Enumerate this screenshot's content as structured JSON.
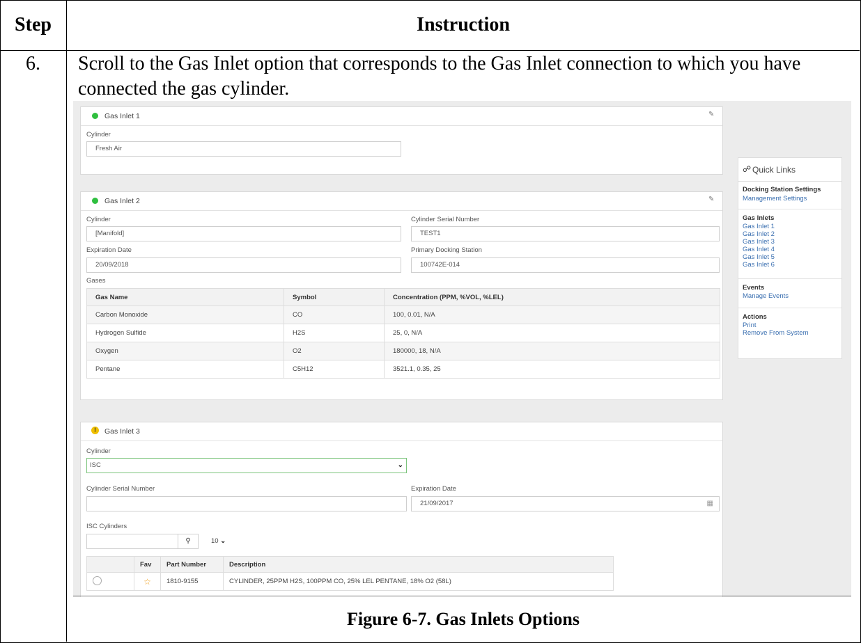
{
  "header": {
    "step": "Step",
    "instruction": "Instruction"
  },
  "row": {
    "step_number": "6.",
    "instruction_text": "Scroll to the Gas Inlet option that corresponds to the Gas Inlet connection to which you have connected the gas cylinder."
  },
  "figure_caption": "Figure 6-7.  Gas Inlets Options",
  "inlet1": {
    "title": "Gas Inlet 1",
    "status": "green",
    "cylinder_label": "Cylinder",
    "cylinder_value": "Fresh Air"
  },
  "inlet2": {
    "title": "Gas Inlet 2",
    "status": "green",
    "cylinder_label": "Cylinder",
    "cylinder_value": "[Manifold]",
    "serial_label": "Cylinder Serial Number",
    "serial_value": "TEST1",
    "exp_label": "Expiration Date",
    "exp_value": "20/09/2018",
    "primary_label": "Primary Docking Station",
    "primary_value": "100742E-014",
    "gases_label": "Gases",
    "columns": [
      "Gas Name",
      "Symbol",
      "Concentration (PPM, %VOL, %LEL)"
    ],
    "rows": [
      [
        "Carbon Monoxide",
        "CO",
        "100, 0.01, N/A"
      ],
      [
        "Hydrogen Sulfide",
        "H2S",
        "25, 0, N/A"
      ],
      [
        "Oxygen",
        "O2",
        "180000, 18, N/A"
      ],
      [
        "Pentane",
        "C5H12",
        "3521.1, 0.35, 25"
      ]
    ]
  },
  "inlet3": {
    "title": "Gas Inlet 3",
    "status": "warning",
    "cylinder_label": "Cylinder",
    "cylinder_value": "ISC",
    "serial_label": "Cylinder Serial Number",
    "serial_value": "",
    "exp_label": "Expiration Date",
    "exp_value": "21/09/2017",
    "isc_label": "ISC Cylinders",
    "page_size": "10",
    "columns": [
      "",
      "Fav",
      "Part Number",
      "Description"
    ],
    "rows": [
      [
        "",
        "",
        "1810-9155",
        "CYLINDER, 25PPM H2S, 100PPM CO, 25% LEL PENTANE, 18% O2 (58L)"
      ]
    ]
  },
  "quick_links": {
    "title": "Quick Links",
    "sections": [
      {
        "title": "Docking Station Settings",
        "links": [
          "Management Settings"
        ]
      },
      {
        "title": "Gas Inlets",
        "links": [
          "Gas Inlet 1",
          "Gas Inlet 2",
          "Gas Inlet 3",
          "Gas Inlet 4",
          "Gas Inlet 5",
          "Gas Inlet 6"
        ]
      },
      {
        "title": "Events",
        "links": [
          "Manage Events"
        ]
      },
      {
        "title": "Actions",
        "links": [
          "Print",
          "Remove From System"
        ]
      }
    ]
  },
  "colors": {
    "status_ok": "#2fbf3f",
    "status_warn": "#f0c000",
    "link": "#3a6fb0"
  }
}
